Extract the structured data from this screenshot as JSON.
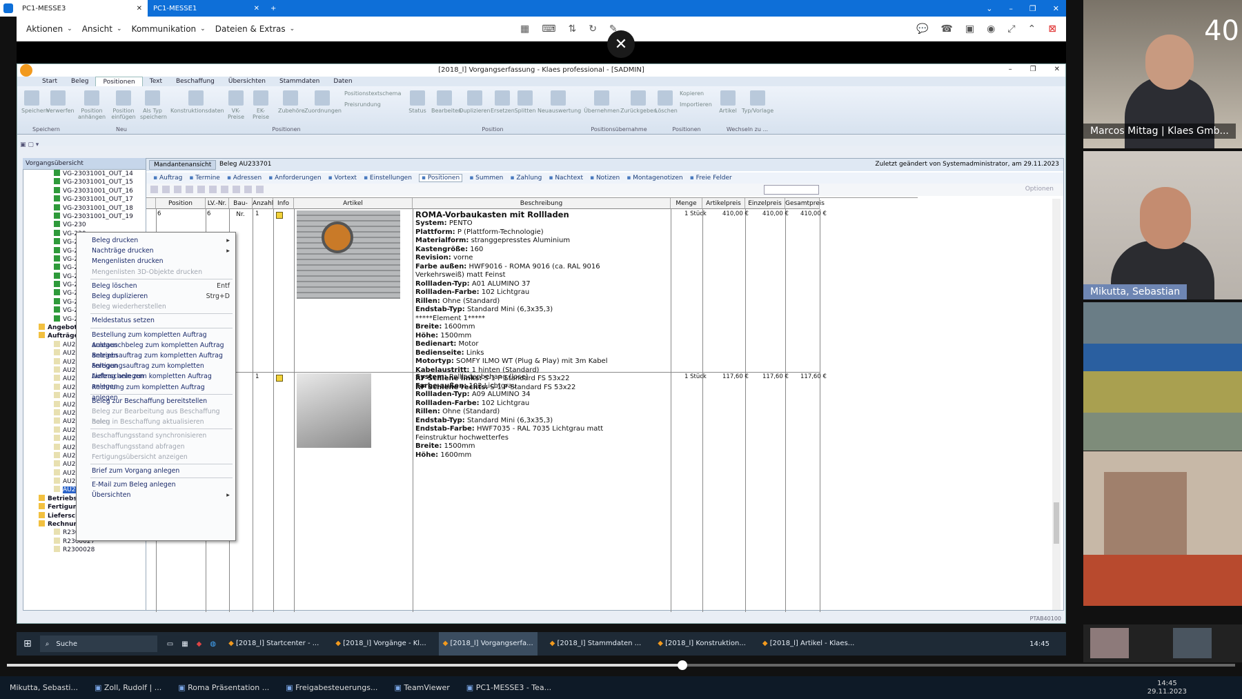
{
  "teamviewer": {
    "tabs": [
      {
        "label": "PC1-MESSE3",
        "active": true
      },
      {
        "label": "PC1-MESSE1",
        "active": false
      }
    ],
    "new_tab_symbol": "+",
    "menu": [
      "Aktionen",
      "Ansicht",
      "Kommunikation",
      "Dateien & Extras"
    ]
  },
  "klaes": {
    "title": "[2018_l] Vorgangserfassung - Klaes professional - [SADMIN]",
    "ribbon_tabs": [
      "Start",
      "Beleg",
      "Positionen",
      "Text",
      "Beschaffung",
      "Übersichten",
      "Stammdaten",
      "Daten"
    ],
    "ribbon_buttons": [
      "Speichern",
      "Verwerfen",
      "Position anhängen",
      "Position einfügen",
      "Als Typ speichern",
      "Konstruktionsdaten",
      "VK-Preise",
      "EK-Preise",
      "Zubehöre",
      "Zuordnungen",
      "Positionstextschema",
      "Preisrundung",
      "Status",
      "Bearbeiten",
      "Duplizieren",
      "Ersetzen",
      "Splitten",
      "Neuauswertung",
      "Übernehmen",
      "Zurückgeben",
      "Löschen",
      "Kopieren",
      "Importieren",
      "Artikel",
      "Typ/Vorlage"
    ],
    "ribbon_groups": [
      "Speichern",
      "Neu",
      "Positionen",
      "Position",
      "Positionsübernahme",
      "Positionen",
      "Wechseln zu ..."
    ],
    "tree_title": "Vorgangsübersicht",
    "tree_items": [
      "VG-23031001_OUT_14",
      "VG-23031001_OUT_15",
      "VG-23031001_OUT_16",
      "VG-23031001_OUT_17",
      "VG-23031001_OUT_18",
      "VG-23031001_OUT_19",
      "VG-230",
      "VG-230",
      "VG-230",
      "VG-230",
      "VG-230",
      "VG-230",
      "VG-230",
      "VG-230",
      "VG-230",
      "VG-230",
      "VG-230",
      "VG-230",
      "Angebote",
      "Aufträge",
      "AU231",
      "AU231",
      "AU231",
      "AU231",
      "AU231",
      "AU231",
      "AU231",
      "AU231",
      "AU232",
      "AU232",
      "AU232",
      "AU232",
      "AU232",
      "AU232",
      "AU232",
      "AU233",
      "AU233",
      "AU233",
      "Betriebsaufträge",
      "Fertigungsaufträge",
      "Lieferscheine",
      "Rechnungen",
      "R2300026",
      "R2300027",
      "R2300028"
    ],
    "content_tabs": [
      "Mandantenansicht",
      "Beleg AU233701"
    ],
    "last_changed": "Zuletzt geändert von Systemadministrator, am 29.11.2023",
    "subtabs": [
      "Auftrag",
      "Termine",
      "Adressen",
      "Anforderungen",
      "Vortext",
      "Einstellungen",
      "Positionen",
      "Summen",
      "Zahlung",
      "Nachtext",
      "Notizen",
      "Montagenotizen",
      "Freie Felder"
    ],
    "options_label": "Optionen",
    "columns": [
      "Position",
      "LV.-Nr.",
      "Bau-Nr.",
      "Anzahl",
      "Info",
      "Artikel",
      "Beschreibung",
      "Menge",
      "Artikelpreis",
      "Einzelpreis",
      "Gesamtpreis"
    ],
    "rows": [
      {
        "position": "6",
        "lv": "6",
        "anzahl": "1",
        "title": "ROMA-Vorbaukasten mit Rollladen",
        "lines": [
          [
            "System:",
            "PENTO"
          ],
          [
            "Plattform:",
            "P (Plattform-Technologie)"
          ],
          [
            "Materialform:",
            "stranggepresstes Aluminium"
          ],
          [
            "Kastengröße:",
            "160"
          ],
          [
            "Revision:",
            "vorne"
          ],
          [
            "Farbe außen:",
            "HWF9016 - ROMA  9016 (ca. RAL 9016"
          ],
          [
            "",
            "Verkehrsweiß) matt Feinst"
          ],
          [
            "Rollladen-Typ:",
            "A01   ALUMINO 37"
          ],
          [
            "Rollladen-Farbe:",
            "102 Lichtgrau"
          ],
          [
            "Rillen:",
            "Ohne (Standard)"
          ],
          [
            "Endstab-Typ:",
            "Standard Mini (6,3x35,3)"
          ],
          [
            "",
            "*****Element 1*****"
          ],
          [
            "Breite:",
            "1600mm"
          ],
          [
            "Höhe:",
            "1500mm"
          ],
          [
            "Bedienart:",
            "Motor"
          ],
          [
            "Bedienseite:",
            "Links"
          ],
          [
            "Motortyp:",
            "SOMFY ILMO WT (Plug & Play) mit 3m Kabel"
          ],
          [
            "Kabelaustritt:",
            "1   hinten (Standard)"
          ],
          [
            "RF Schiene links:",
            "S-1   P Standard FS 53x22"
          ],
          [
            "RF Schiene rechts:",
            "S-1   P Standard FS 53x22"
          ]
        ],
        "menge": "1 Stück",
        "artikelpreis": "410,00 €",
        "einzelpreis": "410,00 €",
        "gesamtpreis": "410,00 €"
      },
      {
        "position": "",
        "lv": "",
        "anzahl": "1",
        "title": "",
        "lines": [
          [
            "System:",
            "Rollladenbehang (lose)"
          ],
          [
            "Farbe außen:",
            "102 Lichtgrau"
          ],
          [
            "Rollladen-Typ:",
            "A09   ALUMINO 34"
          ],
          [
            "Rollladen-Farbe:",
            "102 Lichtgrau"
          ],
          [
            "Rillen:",
            "Ohne (Standard)"
          ],
          [
            "Endstab-Typ:",
            "Standard Mini (6,3x35,3)"
          ],
          [
            "Endstab-Farbe:",
            "HWF7035 - RAL 7035 Lichtgrau matt"
          ],
          [
            "",
            "Feinstruktur hochwetterfes"
          ],
          [
            "Breite:",
            "1500mm"
          ],
          [
            "Höhe:",
            "1600mm"
          ]
        ],
        "menge": "1 Stück",
        "artikelpreis": "117,60 €",
        "einzelpreis": "117,60 €",
        "gesamtpreis": "117,60 €"
      }
    ],
    "status_code": "PTAB40100",
    "context_menu": [
      {
        "label": "Beleg drucken",
        "submenu": true
      },
      {
        "label": "Nachträge drucken",
        "submenu": true
      },
      {
        "label": "Mengenlisten drucken"
      },
      {
        "label": "Mengenlisten 3D-Objekte drucken",
        "disabled": true
      },
      {
        "sep": true
      },
      {
        "label": "Beleg löschen",
        "shortcut": "Entf"
      },
      {
        "label": "Beleg duplizieren",
        "shortcut": "Strg+D"
      },
      {
        "label": "Beleg wiederherstellen",
        "disabled": true
      },
      {
        "sep": true
      },
      {
        "label": "Meldestatus setzen"
      },
      {
        "sep": true
      },
      {
        "label": "Bestellung zum kompletten Auftrag anlegen"
      },
      {
        "label": "Austauschbeleg zum kompletten Auftrag anlegen"
      },
      {
        "label": "Betriebsauftrag zum kompletten Auftrag anlegen"
      },
      {
        "label": "Fertigungsauftrag zum kompletten Auftrag anlegen"
      },
      {
        "label": "Lieferschein zum kompletten Auftrag anlegen"
      },
      {
        "label": "Rechnung zum kompletten Auftrag anlegen"
      },
      {
        "sep": true
      },
      {
        "label": "Beleg zur Beschaffung bereitstellen"
      },
      {
        "label": "Beleg zur Bearbeitung aus Beschaffung holen",
        "disabled": true
      },
      {
        "label": "Beleg in Beschaffung aktualisieren",
        "disabled": true
      },
      {
        "sep": true
      },
      {
        "label": "Beschaffungsstand synchronisieren",
        "disabled": true
      },
      {
        "label": "Beschaffungsstand abfragen",
        "disabled": true
      },
      {
        "label": "Fertigungsübersicht anzeigen",
        "disabled": true
      },
      {
        "sep": true
      },
      {
        "label": "Brief zum Vorgang anlegen"
      },
      {
        "sep": true
      },
      {
        "label": "E-Mail zum Beleg anlegen"
      },
      {
        "label": "Übersichten",
        "submenu": true
      }
    ]
  },
  "remote_taskbar": {
    "search": "Suche",
    "items": [
      "[2018_l] Startcenter - ...",
      "[2018_l] Vorgänge - Kl...",
      "[2018_l] Vorgangserfa...",
      "[2018_l] Stammdaten ...",
      "[2018_l] Konstruktion...",
      "[2018_l] Artikel - Klaes..."
    ],
    "active_index": 2,
    "time": "14:45"
  },
  "video": {
    "progress": 0.55,
    "participants": [
      "Marcos Mittag | Klaes Gmb...",
      "Mikutta, Sebastian"
    ],
    "corner_text": "40"
  },
  "local_taskbar": {
    "items": [
      "Zoll, Rudolf | ...",
      "Roma Präsentation ...",
      "Freigabesteuerungs...",
      "TeamViewer",
      "PC1-MESSE3 - Tea..."
    ],
    "bottom_left_name": "Mikutta, Sebasti...",
    "time": "14:45",
    "date": "29.11.2023"
  },
  "colors": {
    "tv_blue": "#0e6fd8",
    "ribbon": "#dfe8f3",
    "menu_text": "#1a2a6a"
  }
}
